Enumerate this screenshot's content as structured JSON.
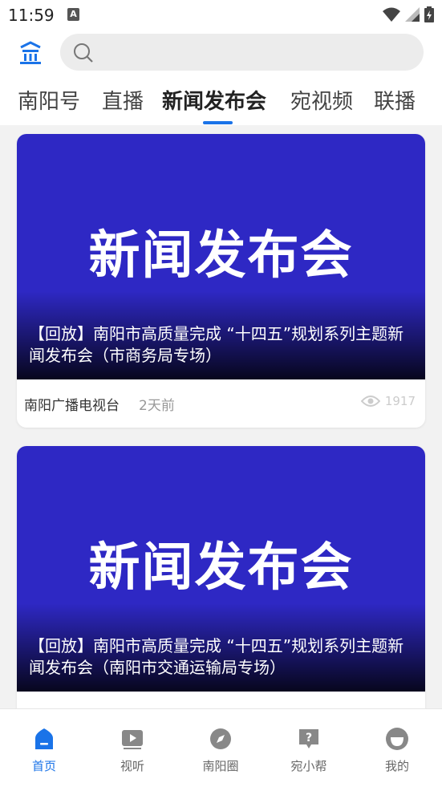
{
  "status": {
    "time": "11:59",
    "notif_letter": "A"
  },
  "tabs": [
    {
      "label": "南阳号",
      "active": false
    },
    {
      "label": "直播",
      "active": false
    },
    {
      "label": "新闻发布会",
      "active": true
    },
    {
      "label": "宛视频",
      "active": false
    },
    {
      "label": "联播",
      "active": false
    }
  ],
  "cards": [
    {
      "image_text": "新闻发布会",
      "title": "【回放】南阳市高质量完成 “十四五”规划系列主题新闻发布会（市商务局专场）",
      "source": "南阳广播电视台",
      "time": "2天前",
      "views": "1917"
    },
    {
      "image_text": "新闻发布会",
      "title": "【回放】南阳市高质量完成 “十四五”规划系列主题新闻发布会（南阳市交通运输局专场）"
    }
  ],
  "nav": [
    {
      "label": "首页",
      "icon": "home-icon",
      "active": true
    },
    {
      "label": "视听",
      "icon": "play-icon",
      "active": false
    },
    {
      "label": "南阳圈",
      "icon": "compass-icon",
      "active": false
    },
    {
      "label": "宛小帮",
      "icon": "help-icon",
      "active": false
    },
    {
      "label": "我的",
      "icon": "profile-icon",
      "active": false
    }
  ],
  "colors": {
    "accent": "#1a73e8",
    "thumb_bg": "#2e28c4"
  }
}
